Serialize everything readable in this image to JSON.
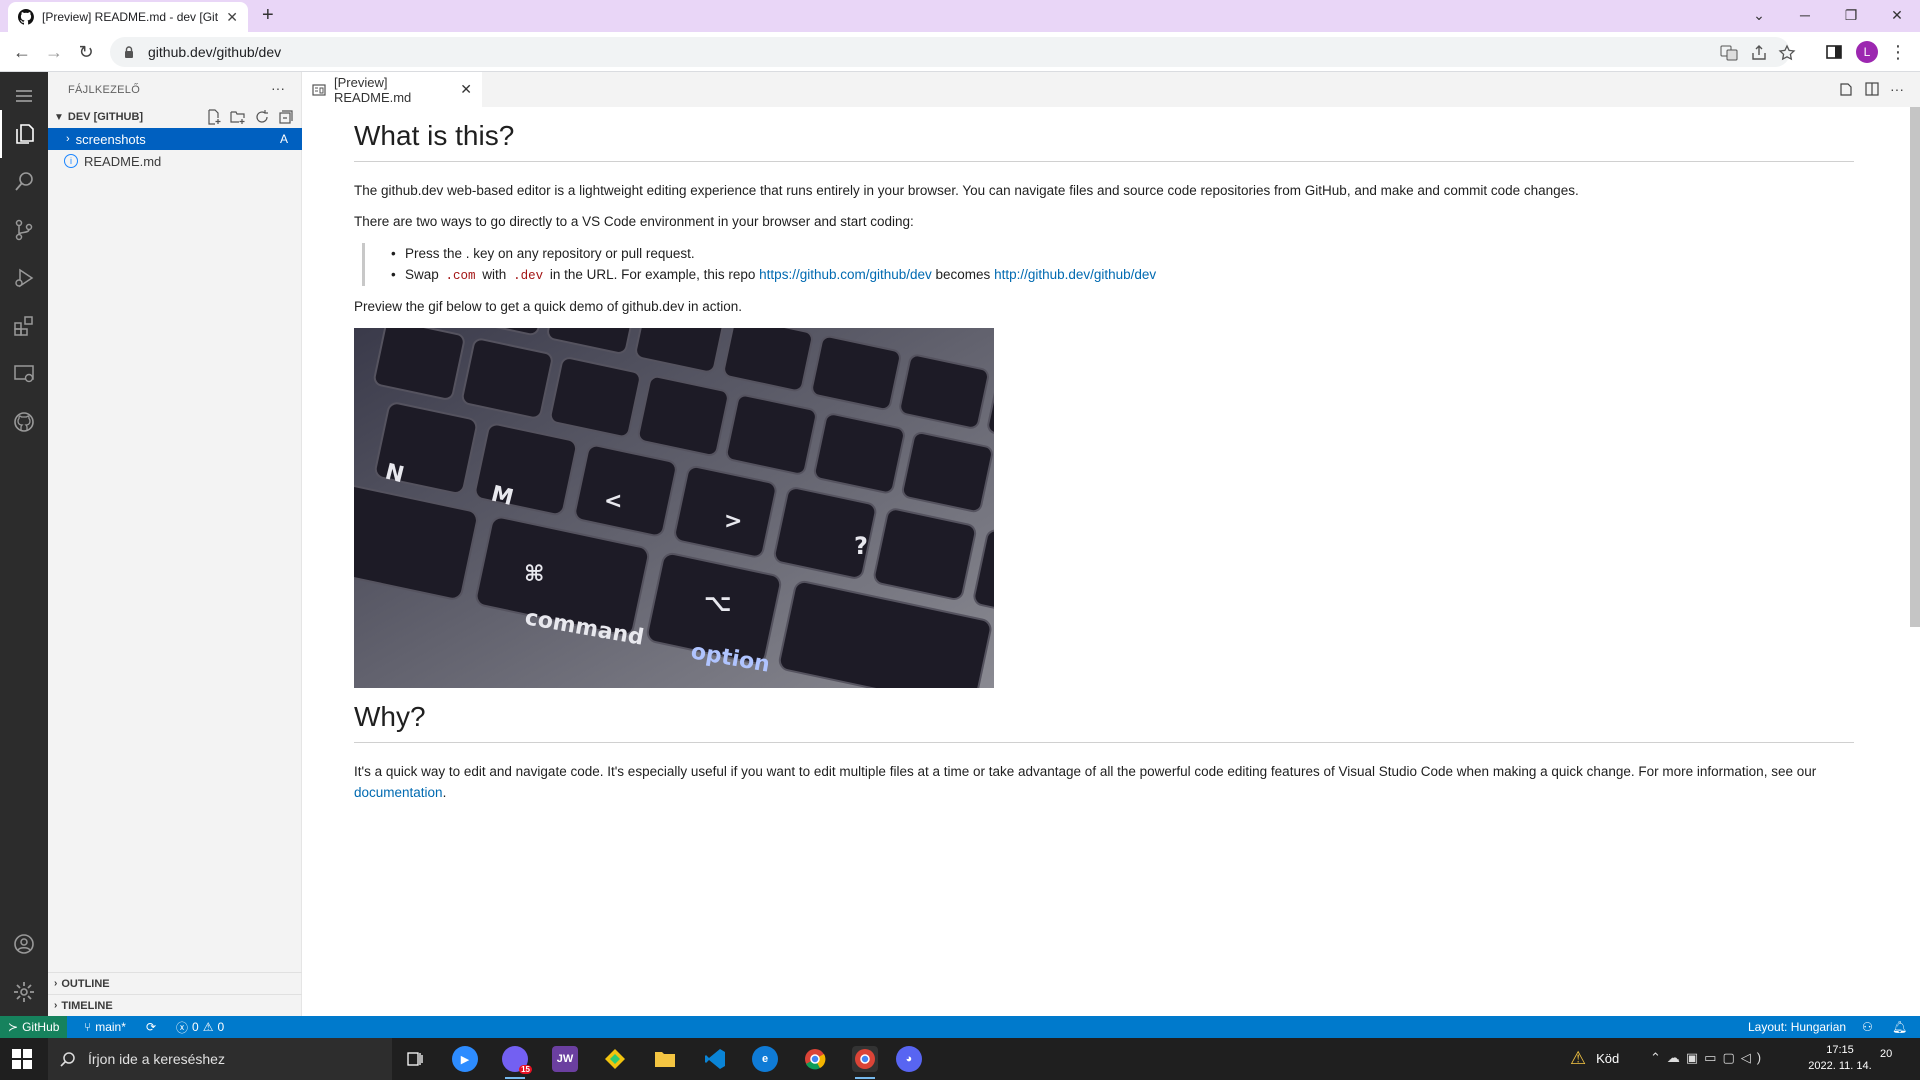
{
  "browser": {
    "tab_title": "[Preview] README.md - dev [Git",
    "url": "github.dev/github/dev",
    "profile_initial": "L"
  },
  "vscode": {
    "sidebar": {
      "title": "FÁJLKEZELŐ",
      "section": "DEV [GITHUB]",
      "items": [
        {
          "label": "screenshots",
          "badge": "A"
        },
        {
          "label": "README.md"
        }
      ],
      "outline": "OUTLINE",
      "timeline": "TIMELINE"
    },
    "editor": {
      "tab_label": "[Preview] README.md"
    },
    "preview": {
      "h1_what": "What is this?",
      "p1": "The github.dev web-based editor is a lightweight editing experience that runs entirely in your browser. You can navigate files and source code repositories from GitHub, and make and commit code changes.",
      "p2": "There are two ways to go directly to a VS Code environment in your browser and start coding:",
      "li1": "Press the . key on any repository or pull request.",
      "li2_a": "Swap ",
      "li2_code1": ".com",
      "li2_b": " with ",
      "li2_code2": ".dev",
      "li2_c": " in the URL. For example, this repo ",
      "li2_link1": "https://github.com/github/dev",
      "li2_d": " becomes ",
      "li2_link2": "http://github.dev/github/dev",
      "p3": "Preview the gif below to get a quick demo of github.dev in action.",
      "h1_why": "Why?",
      "p4": "It's a quick way to edit and navigate code. It's especially useful if you want to edit multiple files at a time or take advantage of all the powerful code editing features of Visual Studio Code when making a quick change. For more information, see our ",
      "p4_link": "documentation",
      "p4_end": "."
    },
    "statusbar": {
      "remote": "GitHub",
      "branch": "main*",
      "errors": "0",
      "warnings": "0",
      "layout": "Layout: Hungarian"
    }
  },
  "taskbar": {
    "search_placeholder": "Írjon ide a kereséshez",
    "weather": "Köd",
    "time": "17:15",
    "date": "2022. 11. 14.",
    "notifications": "20",
    "viber_badge": "15"
  },
  "colors": {
    "accent": "#007acc",
    "selection": "#0060c0",
    "link": "#006ab1"
  }
}
